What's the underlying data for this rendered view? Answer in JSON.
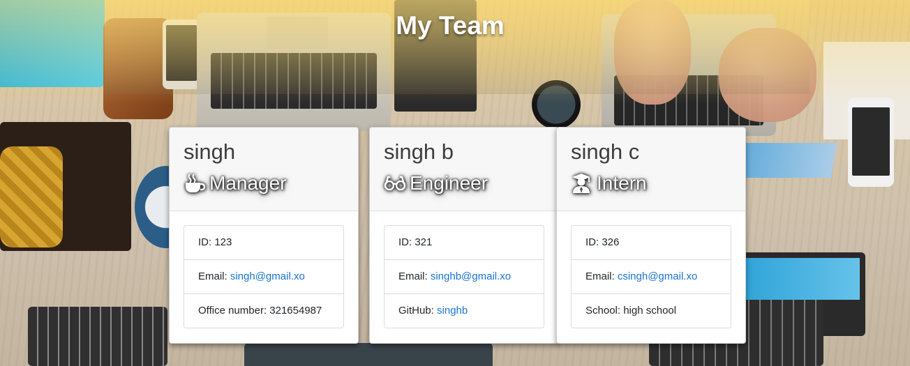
{
  "page": {
    "title": "My Team"
  },
  "cards": [
    {
      "name": "singh",
      "role": "Manager",
      "role_icon": "coffee-icon",
      "id_label": "ID: ",
      "id": "123",
      "email_label": "Email: ",
      "email": "singh@gmail.xo",
      "extra_label": "Office number: ",
      "extra_value": "321654987"
    },
    {
      "name": "singh b",
      "role": "Engineer",
      "role_icon": "glasses-icon",
      "id_label": "ID: ",
      "id": "321",
      "email_label": "Email: ",
      "email": "singhb@gmail.xo",
      "extra_label": "GitHub: ",
      "extra_value": "singhb"
    },
    {
      "name": "singh c",
      "role": "Intern",
      "role_icon": "graduate-icon",
      "id_label": "ID: ",
      "id": "326",
      "email_label": "Email: ",
      "email": "csingh@gmail.xo",
      "extra_label": "School: ",
      "extra_value": "high school"
    }
  ],
  "colors": {
    "link": "#1a73d1",
    "card_header_bg": "#f7f7f7",
    "title_text": "#ffffff"
  }
}
